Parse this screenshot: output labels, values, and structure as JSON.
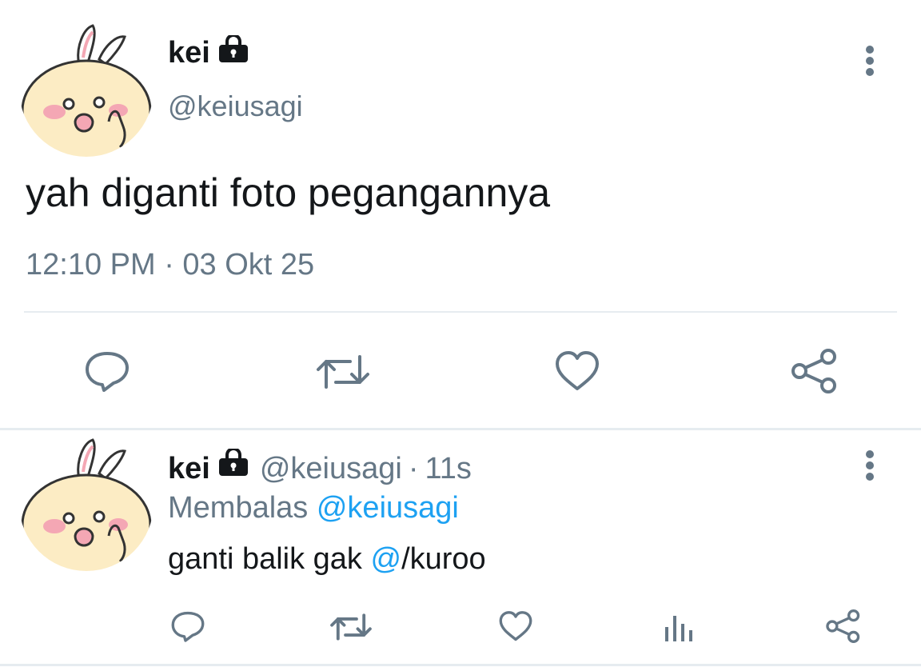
{
  "main_tweet": {
    "display_name": "kei",
    "handle": "@keiusagi",
    "text": "yah diganti foto pegangannya",
    "timestamp": "12:10 PM · 03 Okt 25",
    "actions": [
      "reply-icon",
      "retweet-icon",
      "like-icon",
      "share-icon"
    ]
  },
  "reply_tweet": {
    "display_name": "kei",
    "handle": "@keiusagi",
    "separator": "·",
    "age": "11s",
    "replying_prefix": "Membalas",
    "replying_to": "@keiusagi",
    "text_before": "ganti balik gak ",
    "mention": "@",
    "text_after": "/kuroo",
    "actions": [
      "reply-icon",
      "retweet-icon",
      "like-icon",
      "analytics-icon",
      "share-icon"
    ]
  },
  "colors": {
    "text": "#14171a",
    "muted": "#657786",
    "link": "#1da1f2",
    "divider": "#e6ecf0"
  }
}
